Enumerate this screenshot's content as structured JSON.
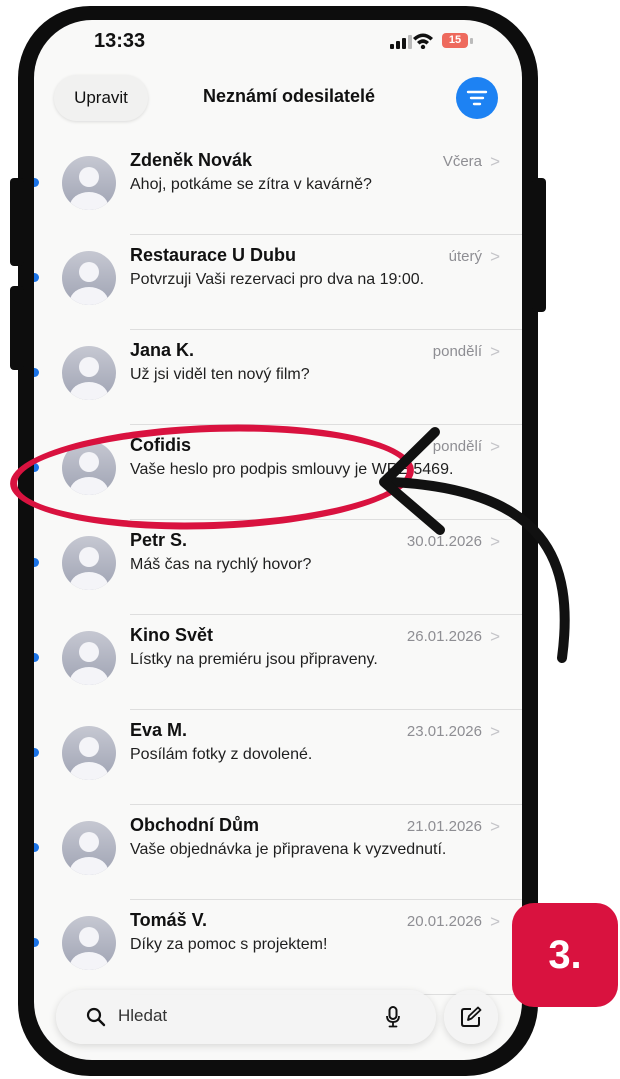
{
  "status_bar": {
    "time": "13:33",
    "battery": "15"
  },
  "header": {
    "edit_label": "Upravit",
    "title": "Neznámí odesilatelé"
  },
  "messages": [
    {
      "name": "Zdeněk Novák",
      "date": "Včera",
      "preview": "Ahoj, potkáme se zítra v kavárně?"
    },
    {
      "name": "Restaurace U Dubu",
      "date": "úterý",
      "preview": "Potvrzuji Vaši rezervaci pro dva na 19:00."
    },
    {
      "name": "Jana K.",
      "date": "pondělí",
      "preview": "Už jsi viděl ten nový film?"
    },
    {
      "name": "Cofidis",
      "date": "pondělí",
      "preview": "Vaše heslo pro podpis smlouvy je WREt5469."
    },
    {
      "name": "Petr S.",
      "date": "30.01.2026",
      "preview": "Máš čas na rychlý hovor?"
    },
    {
      "name": "Kino Svět",
      "date": "26.01.2026",
      "preview": "Lístky na premiéru jsou připraveny."
    },
    {
      "name": "Eva M.",
      "date": "23.01.2026",
      "preview": "Posílám fotky z dovolené."
    },
    {
      "name": "Obchodní Dům",
      "date": "21.01.2026",
      "preview": "Vaše objednávka je připravena k vyzvednutí."
    },
    {
      "name": "Tomáš V.",
      "date": "20.01.2026",
      "preview": "Díky za pomoc s projektem!"
    }
  ],
  "search": {
    "placeholder": "Hledat"
  },
  "annotation": {
    "step_label": "3."
  },
  "colors": {
    "accent": "#1d82f3",
    "unread": "#1a73e8",
    "highlight": "#d9123f",
    "battery": "#ee6a5d"
  },
  "icons": [
    "search-icon",
    "microphone-icon",
    "compose-icon",
    "filter-icon",
    "chevron-right-icon",
    "wifi-icon",
    "signal-icon",
    "avatar-icon"
  ]
}
